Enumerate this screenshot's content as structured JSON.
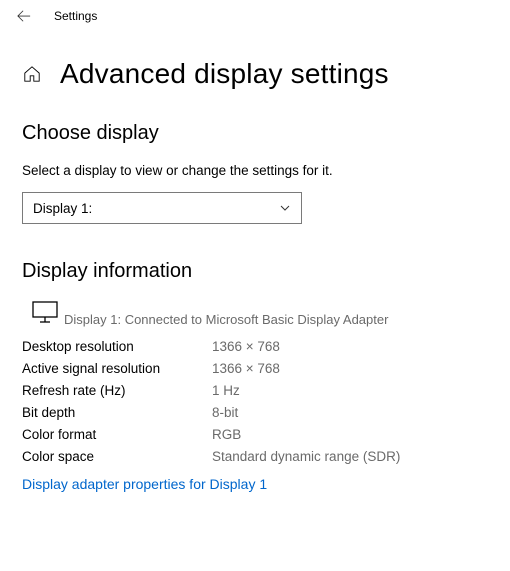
{
  "titlebar": {
    "title": "Settings"
  },
  "page": {
    "title": "Advanced display settings"
  },
  "choose_display": {
    "heading": "Choose display",
    "subtitle": "Select a display to view or change the settings for it.",
    "selected": "Display 1:"
  },
  "display_info": {
    "heading": "Display information",
    "connected": "Display 1: Connected to Microsoft Basic Display Adapter",
    "rows": [
      {
        "label": "Desktop resolution",
        "value": "1366 × 768"
      },
      {
        "label": "Active signal resolution",
        "value": "1366 × 768"
      },
      {
        "label": "Refresh rate (Hz)",
        "value": "1 Hz"
      },
      {
        "label": "Bit depth",
        "value": "8-bit"
      },
      {
        "label": "Color format",
        "value": "RGB"
      },
      {
        "label": "Color space",
        "value": "Standard dynamic range (SDR)"
      }
    ],
    "adapter_link": "Display adapter properties for Display 1"
  }
}
